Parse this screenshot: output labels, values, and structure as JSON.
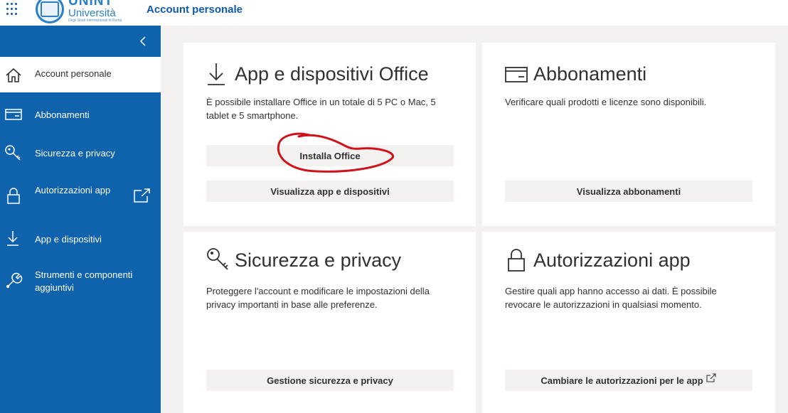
{
  "header": {
    "logo_name": "UNINT",
    "logo_sub": "Università",
    "logo_tagline": "Degli Studi Internazionali di Roma",
    "app_title": "Account personale"
  },
  "sidebar": {
    "collapse_icon": "chevron-left-icon",
    "items": [
      {
        "label": "Account personale",
        "icon": "home-icon",
        "active": true
      },
      {
        "label": "Abbonamenti",
        "icon": "card-icon"
      },
      {
        "label": "Sicurezza e privacy",
        "icon": "key-icon"
      },
      {
        "label": "Autorizzazioni app",
        "icon": "lock-icon",
        "external": true
      },
      {
        "label": "App e dispositivi",
        "icon": "download-icon"
      },
      {
        "label": "Strumenti e componenti aggiuntivi",
        "icon": "wrench-icon"
      }
    ]
  },
  "cards": {
    "apps": {
      "title": "App e dispositivi Office",
      "desc": "È possibile installare Office in un totale di 5 PC o Mac, 5 tablet e 5 smartphone.",
      "btn_install": "Installa Office",
      "btn_view": "Visualizza app e dispositivi"
    },
    "subs": {
      "title": "Abbonamenti",
      "desc": "Verificare quali prodotti e licenze sono disponibili.",
      "btn_view": "Visualizza abbonamenti"
    },
    "security": {
      "title": "Sicurezza e privacy",
      "desc": "Proteggere l'account e modificare le impostazioni della privacy importanti in base alle preferenze.",
      "btn_manage": "Gestione sicurezza e privacy"
    },
    "permissions": {
      "title": "Autorizzazioni app",
      "desc": "Gestire quali app hanno accesso ai dati. È possibile revocare le autorizzazioni in qualsiasi momento.",
      "btn_change": "Cambiare le autorizzazioni per le app"
    }
  },
  "colors": {
    "brand": "#0f62ac",
    "annotation": "#d0121b"
  }
}
